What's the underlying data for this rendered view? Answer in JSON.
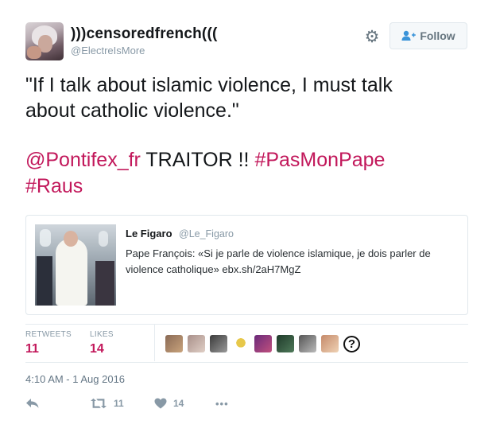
{
  "author": {
    "display_name": ")))censoredfrench(((",
    "username": "@ElectreIsMore"
  },
  "header": {
    "gear_icon": "gear-icon",
    "follow_label": "Follow"
  },
  "tweet": {
    "line1": "\"If I talk about islamic violence, I must talk",
    "line2": "about catholic violence.\"",
    "mention": "@Pontifex_fr",
    "plain": " TRAITOR !! ",
    "hashtag1": "#PasMonPape",
    "hashtag2": "#Raus"
  },
  "quoted": {
    "author": "Le Figaro",
    "handle": "@Le_Figaro",
    "text": "Pape François: «Si je parle de violence islamique, je dois parler de violence catholique» ebx.sh/2aH7MgZ"
  },
  "stats": {
    "retweets_label": "RETWEETS",
    "retweets_value": "11",
    "likes_label": "LIKES",
    "likes_value": "14",
    "more_likers_symbol": "?"
  },
  "timestamp": "4:10 AM - 1 Aug 2016",
  "actions": {
    "retweet_count": "11",
    "like_count": "14",
    "more_symbol": "•••"
  },
  "colors": {
    "link": "#c2185b",
    "muted": "#8899a6"
  }
}
